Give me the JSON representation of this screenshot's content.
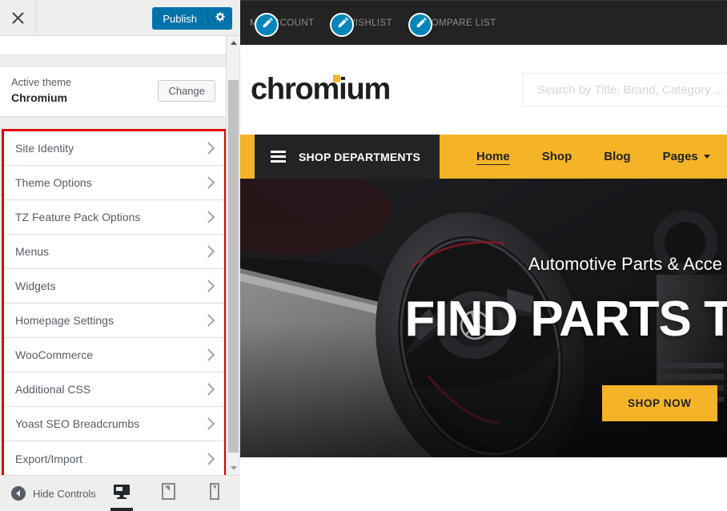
{
  "customizer": {
    "header": {
      "close_icon": "close-icon",
      "publish_label": "Publish",
      "gear_icon": "gear-icon"
    },
    "theme": {
      "label": "Active theme",
      "name": "Chromium",
      "change_label": "Change"
    },
    "sections": [
      {
        "label": "Site Identity"
      },
      {
        "label": "Theme Options"
      },
      {
        "label": "TZ Feature Pack Options"
      },
      {
        "label": "Menus"
      },
      {
        "label": "Widgets"
      },
      {
        "label": "Homepage Settings"
      },
      {
        "label": "WooCommerce"
      },
      {
        "label": "Additional CSS"
      },
      {
        "label": "Yoast SEO Breadcrumbs"
      },
      {
        "label": "Export/Import"
      }
    ],
    "footer": {
      "hide_controls_label": "Hide Controls",
      "devices": [
        {
          "name": "desktop",
          "icon": "desktop-icon",
          "active": true
        },
        {
          "name": "tablet",
          "icon": "tablet-icon",
          "active": false
        },
        {
          "name": "mobile",
          "icon": "mobile-icon",
          "active": false
        }
      ]
    },
    "highlight_color": "#e00000",
    "accent_color": "#0073aa"
  },
  "preview": {
    "topbar": {
      "links": [
        {
          "label": "MY ACCOUNT"
        },
        {
          "label": "WISHLIST"
        },
        {
          "label": "COMPARE LIST"
        }
      ],
      "edit_shortcut_icon": "pencil-icon",
      "edit_shortcut_color": "#0085ba"
    },
    "branding": {
      "logo_text": "chromium",
      "logo_accent_color": "#f5b427"
    },
    "search": {
      "placeholder": "Search by Title, Brand, Category ...",
      "value": ""
    },
    "nav": {
      "departments_label": "SHOP DEPARTMENTS",
      "burger_icon": "hamburger-icon",
      "accent_color": "#f5b427",
      "items": [
        {
          "label": "Home",
          "active": true,
          "has_caret": false
        },
        {
          "label": "Shop",
          "active": false,
          "has_caret": false
        },
        {
          "label": "Blog",
          "active": false,
          "has_caret": false
        },
        {
          "label": "Pages",
          "active": false,
          "has_caret": true
        }
      ]
    },
    "hero": {
      "subtitle": "Automotive Parts & Acce",
      "title": "FIND PARTS T",
      "button_label": "SHOP NOW",
      "button_color": "#f5b427"
    }
  }
}
